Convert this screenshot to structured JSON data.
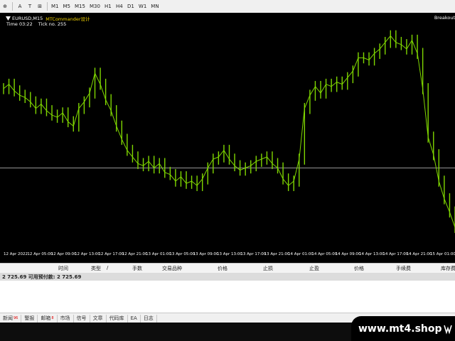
{
  "toolbar": {
    "items": [
      {
        "name": "plus-icon",
        "label": "⊕"
      },
      {
        "name": "text-tool",
        "label": "A"
      },
      {
        "name": "label-tool",
        "label": "T"
      },
      {
        "name": "objects-icon",
        "label": "⊞"
      }
    ],
    "timeframes": [
      "M1",
      "M5",
      "M15",
      "M30",
      "H1",
      "H4",
      "D1",
      "W1",
      "MN"
    ]
  },
  "chart": {
    "symbol": "EURUSD,M15",
    "ea_name": "MTCommander设计",
    "time_label": "Time 03:22",
    "tick_label": "Tick no. 255",
    "corner_label": "Breakout",
    "background": "#000000",
    "candle_color": "#7fd600",
    "line_color": "#9a9a9a"
  },
  "chart_data": {
    "type": "line",
    "series": [
      {
        "values": [
          0.72,
          0.74,
          0.71,
          0.69,
          0.68,
          0.66,
          0.63,
          0.65,
          0.62,
          0.6,
          0.59,
          0.61,
          0.57,
          0.55,
          0.63,
          0.66,
          0.7,
          0.79,
          0.74,
          0.67,
          0.62,
          0.55,
          0.49,
          0.44,
          0.41,
          0.38,
          0.37,
          0.39,
          0.36,
          0.38,
          0.34,
          0.33,
          0.3,
          0.32,
          0.29,
          0.3,
          0.28,
          0.31,
          0.36,
          0.4,
          0.41,
          0.44,
          0.4,
          0.37,
          0.35,
          0.36,
          0.37,
          0.39,
          0.4,
          0.41,
          0.38,
          0.36,
          0.31,
          0.28,
          0.3,
          0.4,
          0.63,
          0.69,
          0.73,
          0.7,
          0.74,
          0.73,
          0.75,
          0.74,
          0.77,
          0.8,
          0.86,
          0.86,
          0.85,
          0.88,
          0.9,
          0.93,
          0.96,
          0.93,
          0.92,
          0.9,
          0.94,
          0.88,
          0.72,
          0.5,
          0.42,
          0.3,
          0.22,
          0.16,
          0.09
        ]
      }
    ],
    "x_ticks": [
      "12 Apr 2022",
      "12 Apr 05:00",
      "12 Apr 09:00",
      "12 Apr 13:00",
      "12 Apr 17:00",
      "12 Apr 21:00",
      "13 Apr 01:00",
      "13 Apr 05:00",
      "13 Apr 09:00",
      "13 Apr 13:00",
      "13 Apr 17:00",
      "13 Apr 21:00",
      "14 Apr 01:00",
      "14 Apr 05:00",
      "14 Apr 09:00",
      "14 Apr 13:00",
      "14 Apr 17:00",
      "14 Apr 21:00",
      "15 Apr 01:00"
    ],
    "hline": 0.36
  },
  "terminal": {
    "columns": [
      "时间",
      "类型",
      "/",
      "手数",
      "交易品种",
      "价格",
      "止损",
      "止盈",
      "价格",
      "手续费",
      "库存费"
    ],
    "balance_text": "2 725.69  可用预付款: 2 725.69"
  },
  "tabs": [
    {
      "label": "新闻",
      "badge": "96"
    },
    {
      "label": "警报",
      "badge": ""
    },
    {
      "label": "邮箱",
      "badge": "8"
    },
    {
      "label": "市场",
      "badge": ""
    },
    {
      "label": "信号",
      "badge": ""
    },
    {
      "label": "文章",
      "badge": ""
    },
    {
      "label": "代码库",
      "badge": ""
    },
    {
      "label": "EA",
      "badge": ""
    },
    {
      "label": "日志",
      "badge": ""
    }
  ],
  "brand": {
    "text": "www.mt4.shop"
  }
}
